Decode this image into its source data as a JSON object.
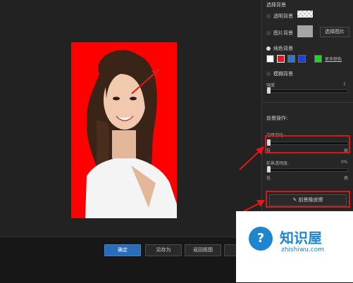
{
  "panel": {
    "section_title": "选择背景",
    "options": {
      "transparent": "透明背景",
      "image": "图片背景",
      "solid": "纯色背景",
      "blur": "模糊背景"
    },
    "select_image_button": "选择图片",
    "more_colors": "更多颜色",
    "colors": [
      "#ffffff",
      "#d42020",
      "#2a78d0",
      "#1e3fd8",
      "#1ed61e"
    ],
    "degree_label": "强度",
    "degree_value": "1",
    "foreground_title": "前景操作:",
    "edge_feather_label": "边缘羽化:",
    "low": "低",
    "high": "高",
    "opacity_label": "前景透明度:",
    "opacity_value": "0%",
    "low2": "低",
    "high2": "高",
    "eraser_button": "前景橡皮擦"
  },
  "bottom": {
    "confirm": "确定",
    "save_as": "另存为",
    "return": "返回抠图"
  },
  "watermark": {
    "brand": "知识屋",
    "url": "zhishiwu.com"
  },
  "colors": {
    "accent_blue": "#2b6cb8",
    "photo_background": "#ff0000",
    "highlight_red": "#d11a1a"
  }
}
